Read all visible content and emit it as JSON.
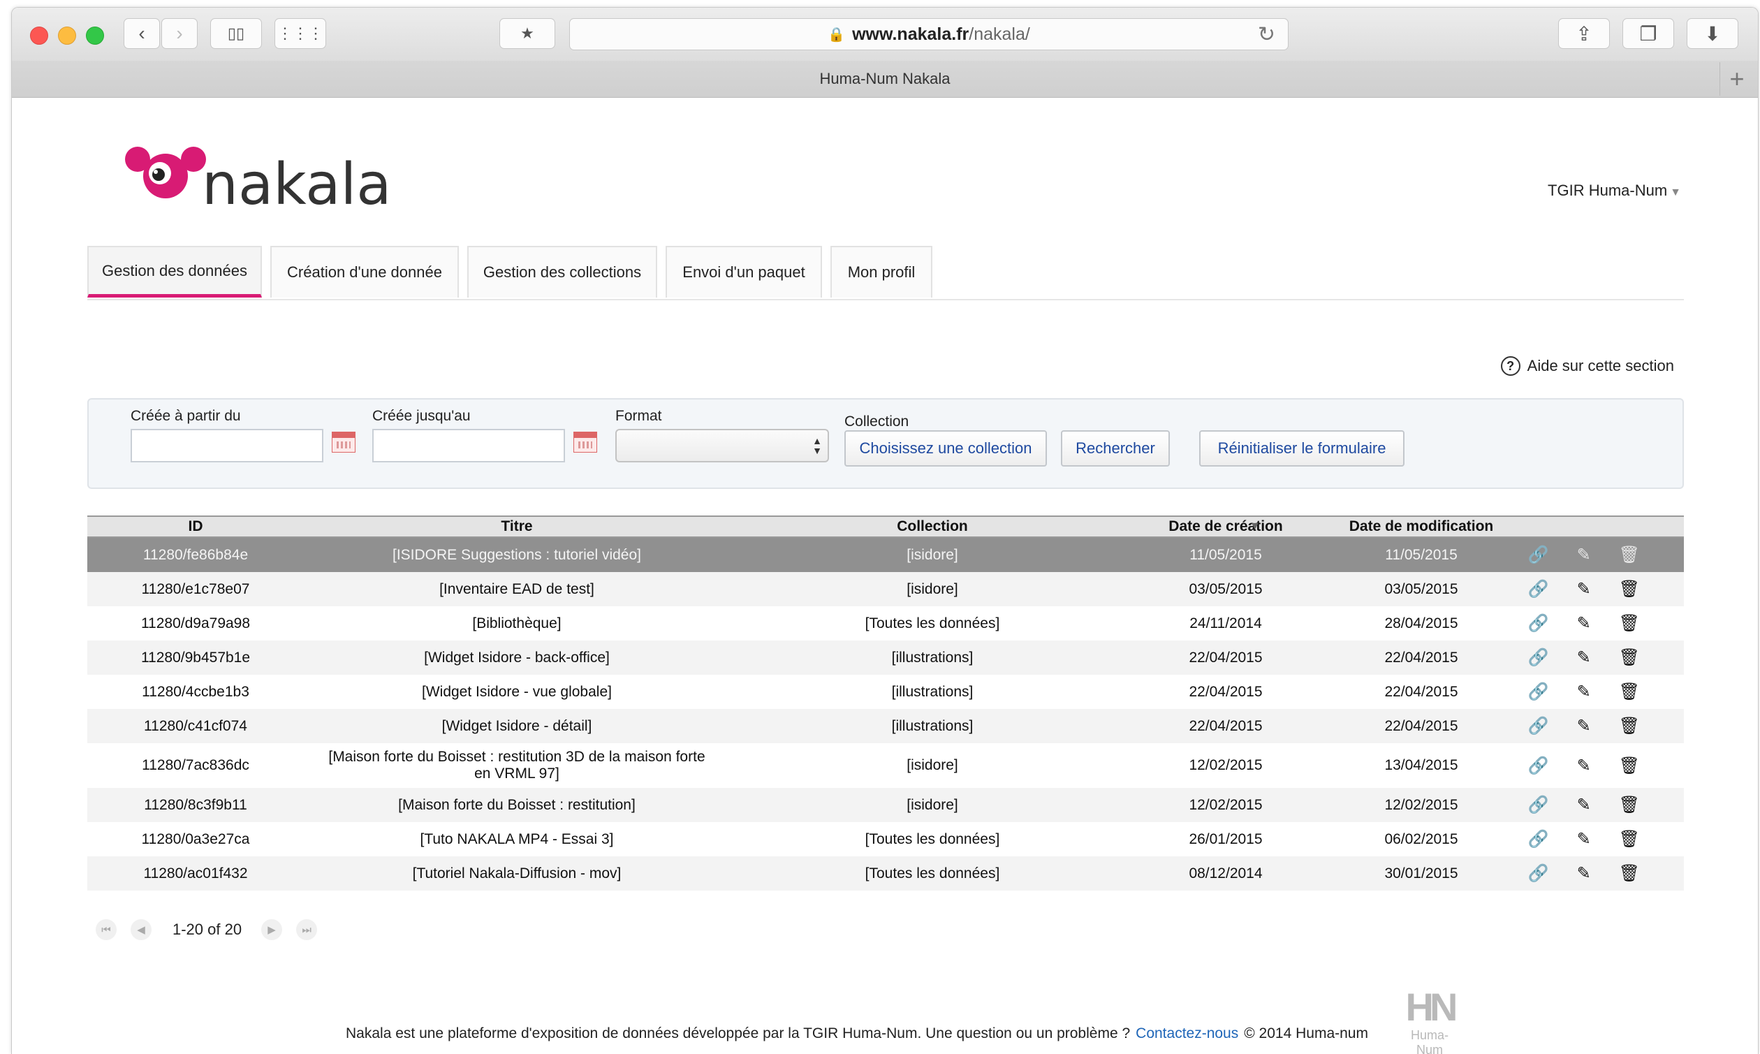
{
  "browser": {
    "url_host": "www.nakala.fr",
    "url_path": "/nakala/",
    "tab_title": "Huma-Num Nakala"
  },
  "header": {
    "logo_text": "nakala",
    "user_name": "TGIR Huma-Num"
  },
  "tabs": [
    {
      "label": "Gestion des données",
      "active": true
    },
    {
      "label": "Création d'une donnée",
      "active": false
    },
    {
      "label": "Gestion des collections",
      "active": false
    },
    {
      "label": "Envoi d'un paquet",
      "active": false
    },
    {
      "label": "Mon profil",
      "active": false
    }
  ],
  "help_label": "Aide sur cette section",
  "filters": {
    "created_from_label": "Créée à partir du",
    "created_until_label": "Créée jusqu'au",
    "format_label": "Format",
    "collection_label": "Collection",
    "choose_collection_button": "Choisissez une collection",
    "search_button": "Rechercher",
    "reset_button": "Réinitialiser le formulaire"
  },
  "table": {
    "columns": [
      "ID",
      "Titre",
      "Collection",
      "Date de création",
      "Date de modification"
    ],
    "sorted_column": "Date de modification",
    "rows": [
      {
        "id": "11280/fe86b84e",
        "title": "[ISIDORE Suggestions : tutoriel vidéo]",
        "collection": "[isidore]",
        "created": "11/05/2015",
        "modified": "11/05/2015",
        "selected": true
      },
      {
        "id": "11280/e1c78e07",
        "title": "[Inventaire EAD de test]",
        "collection": "[isidore]",
        "created": "03/05/2015",
        "modified": "03/05/2015"
      },
      {
        "id": "11280/d9a79a98",
        "title": "[Bibliothèque]",
        "collection": "[Toutes les données]",
        "created": "24/11/2014",
        "modified": "28/04/2015"
      },
      {
        "id": "11280/9b457b1e",
        "title": "[Widget Isidore - back-office]",
        "collection": "[illustrations]",
        "created": "22/04/2015",
        "modified": "22/04/2015"
      },
      {
        "id": "11280/4ccbe1b3",
        "title": "[Widget Isidore - vue globale]",
        "collection": "[illustrations]",
        "created": "22/04/2015",
        "modified": "22/04/2015"
      },
      {
        "id": "11280/c41cf074",
        "title": "[Widget Isidore - détail]",
        "collection": "[illustrations]",
        "created": "22/04/2015",
        "modified": "22/04/2015"
      },
      {
        "id": "11280/7ac836dc",
        "title": "[Maison forte du Boisset : restitution 3D de la maison forte en VRML 97]",
        "collection": "[isidore]",
        "created": "12/02/2015",
        "modified": "13/04/2015",
        "tall": true
      },
      {
        "id": "11280/8c3f9b11",
        "title": "[Maison forte du Boisset : restitution]",
        "collection": "[isidore]",
        "created": "12/02/2015",
        "modified": "12/02/2015"
      },
      {
        "id": "11280/0a3e27ca",
        "title": "[Tuto NAKALA MP4 - Essai 3]",
        "collection": "[Toutes les données]",
        "created": "26/01/2015",
        "modified": "06/02/2015"
      },
      {
        "id": "11280/ac01f432",
        "title": "[Tutoriel Nakala-Diffusion - mov]",
        "collection": "[Toutes les données]",
        "created": "08/12/2014",
        "modified": "30/01/2015"
      }
    ]
  },
  "pager": {
    "info": "1-20 of 20"
  },
  "footer": {
    "text": "Nakala est une plateforme d'exposition de données développée par la TGIR Huma-Num. Une question ou un problème ?",
    "contact_link": "Contactez-nous",
    "copyright": "© 2014 Huma-num",
    "hn_logo_small": "Huma-Num"
  },
  "colors": {
    "brand_pink": "#d81b74",
    "link_blue": "#1f4aa0",
    "selected_row": "#909090"
  }
}
